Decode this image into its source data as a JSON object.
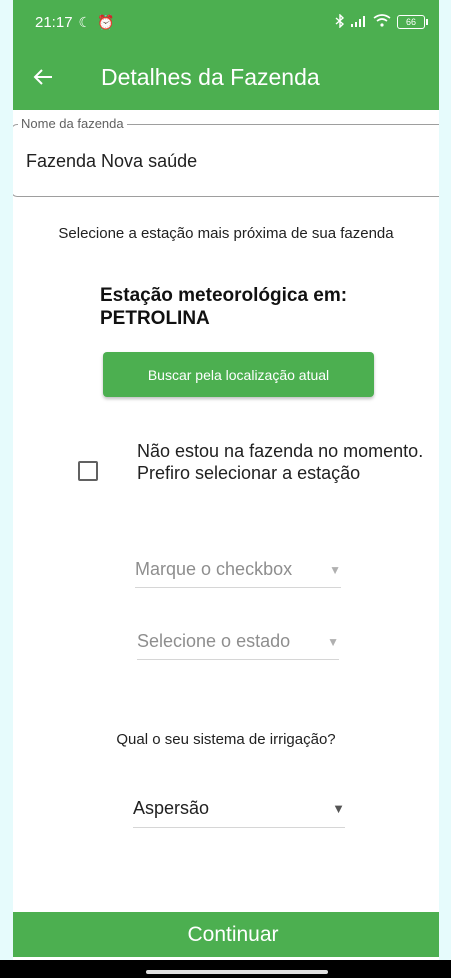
{
  "status_bar": {
    "time": "21:17",
    "battery": "66",
    "icons": [
      "do-not-disturb-icon",
      "alarm-icon",
      "bluetooth-icon",
      "signal-icon",
      "wifi-icon",
      "battery-icon"
    ]
  },
  "app_bar": {
    "title": "Detalhes da Fazenda"
  },
  "form": {
    "farm_name_label": "Nome da fazenda",
    "farm_name_value": "Fazenda Nova saúde",
    "instruction": "Selecione a estação mais próxima de sua fazenda",
    "station_title": "Estação meteorológica em: PETROLINA",
    "locate_button": "Buscar pela localização atual",
    "checkbox_label": "Não estou na fazenda no momento.\nPrefiro selecionar a estação",
    "checkbox_checked": false,
    "dropdown_checkbox_placeholder": "Marque o checkbox",
    "dropdown_state_placeholder": "Selecione o estado",
    "irrigation_question": "Qual o seu sistema de irrigação?",
    "irrigation_value": "Aspersão"
  },
  "footer": {
    "continue_button": "Continuar"
  },
  "colors": {
    "primary": "#4caf50",
    "background_outer": "#e6fbfc"
  }
}
